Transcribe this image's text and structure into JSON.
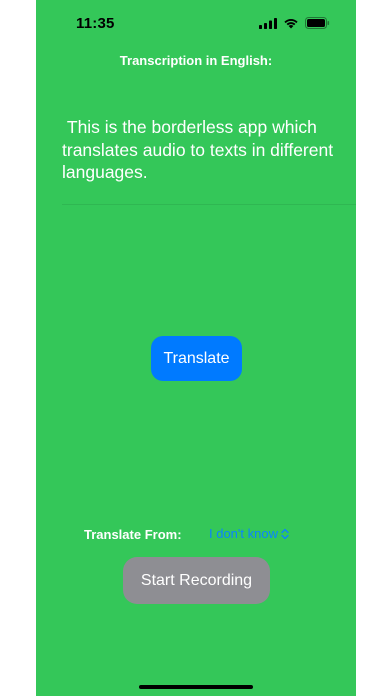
{
  "status_bar": {
    "time": "11:35",
    "icons": [
      "signal-icon",
      "wifi-icon",
      "battery-icon"
    ]
  },
  "header": {
    "title": "Transcription in English:"
  },
  "transcription": {
    "text": " This is the borderless app which translates audio to texts in different languages."
  },
  "actions": {
    "translate_label": "Translate",
    "record_label": "Start Recording"
  },
  "translate_from": {
    "label": "Translate From:",
    "selected": "I don't know"
  },
  "colors": {
    "background": "#34c759",
    "primary_button": "#007aff",
    "secondary_button": "#8e8e93",
    "picker_text": "#0a84ff"
  }
}
